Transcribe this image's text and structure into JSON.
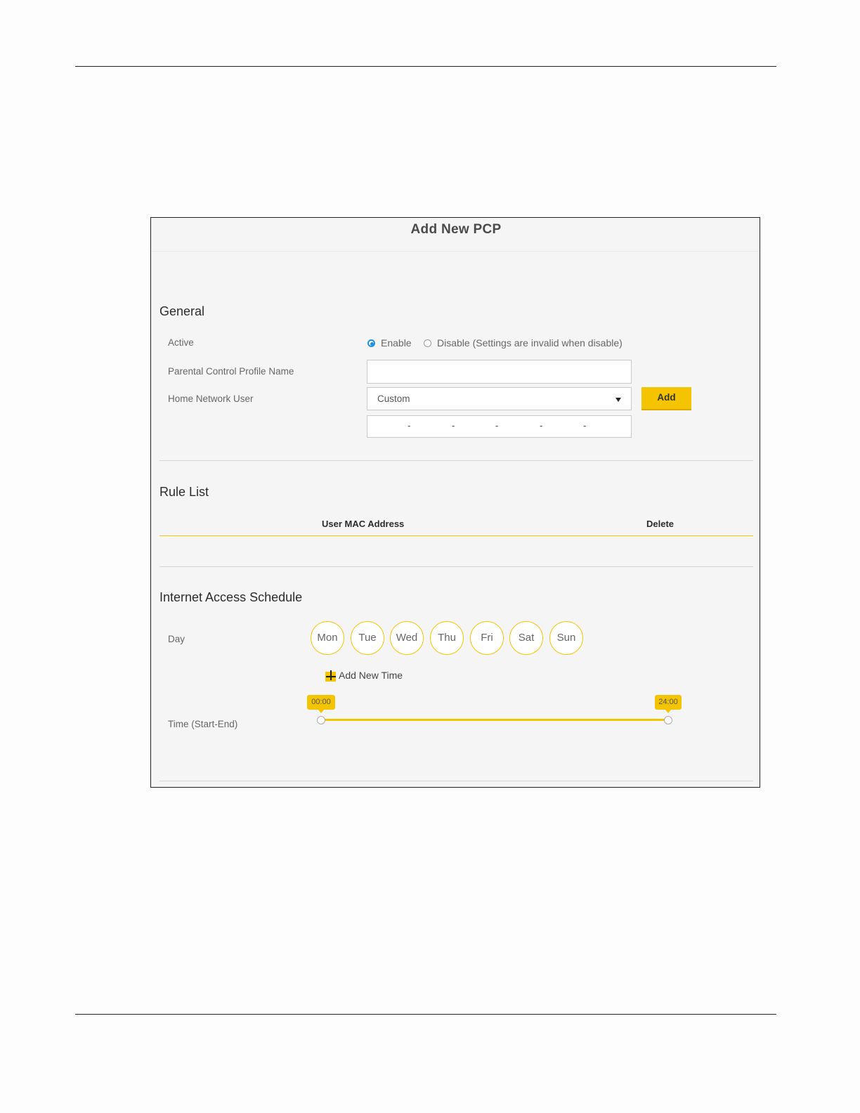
{
  "dialog": {
    "title": "Add New PCP"
  },
  "general": {
    "section_title": "General",
    "active_label": "Active",
    "enable_label": "Enable",
    "disable_label": "Disable (Settings are invalid when disable)",
    "active_selected": "Enable",
    "profile_name_label": "Parental Control Profile Name",
    "profile_name_value": "",
    "home_user_label": "Home Network User",
    "home_user_value": "Custom",
    "add_button": "Add",
    "mac_separators": [
      "-",
      "-",
      "-",
      "-",
      "-"
    ]
  },
  "rule_list": {
    "section_title": "Rule List",
    "columns": [
      "User MAC Address",
      "Delete"
    ],
    "rows": []
  },
  "schedule": {
    "section_title": "Internet Access Schedule",
    "day_label": "Day",
    "days": [
      "Mon",
      "Tue",
      "Wed",
      "Thu",
      "Fri",
      "Sat",
      "Sun"
    ],
    "add_time_label": "Add New Time",
    "time_label": "Time (Start-End)",
    "time_start": "00:00",
    "time_end": "24:00"
  },
  "colors": {
    "accent": "#f5c400",
    "radio_selected": "#1e90e0"
  },
  "icons": {
    "add_time": "plus-icon",
    "dropdown": "caret-down-icon"
  }
}
